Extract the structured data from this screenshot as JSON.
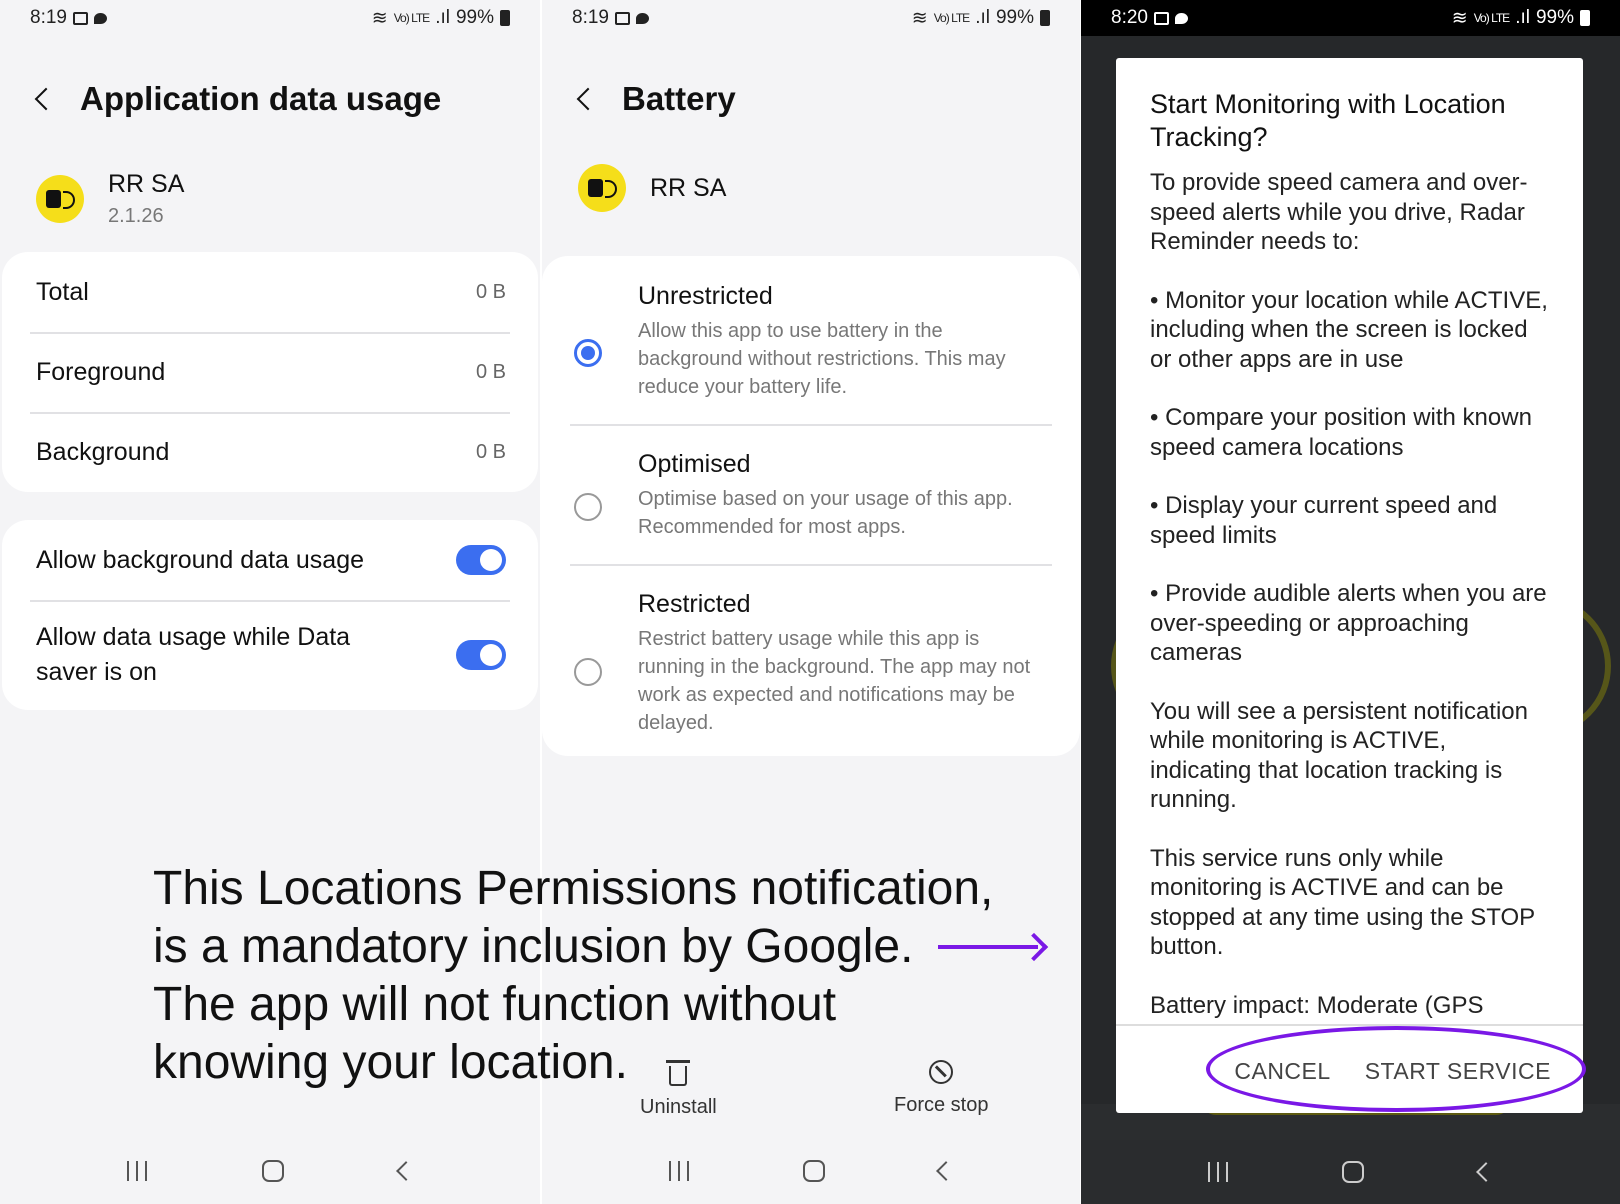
{
  "screen1": {
    "status": {
      "time": "8:19",
      "volte": "Vo) LTE",
      "battery": "99%"
    },
    "title": "Application data usage",
    "app": {
      "name": "RR SA",
      "version": "2.1.26"
    },
    "usage": [
      {
        "label": "Total",
        "value": "0 B"
      },
      {
        "label": "Foreground",
        "value": "0 B"
      },
      {
        "label": "Background",
        "value": "0 B"
      }
    ],
    "toggles": [
      {
        "label": "Allow background data usage",
        "on": true
      },
      {
        "label": "Allow data usage while Data saver is on",
        "on": true
      }
    ]
  },
  "screen2": {
    "status": {
      "time": "8:19",
      "volte": "Vo) LTE",
      "battery": "99%"
    },
    "title": "Battery",
    "app": {
      "name": "RR SA"
    },
    "options": [
      {
        "title": "Unrestricted",
        "desc": "Allow this app to use battery in the background without restrictions. This may reduce your battery life.",
        "selected": true
      },
      {
        "title": "Optimised",
        "desc": "Optimise based on your usage of this app. Recommended for most apps.",
        "selected": false
      },
      {
        "title": "Restricted",
        "desc": "Restrict battery usage while this app is running in the background. The app may not work as expected and notifications may be delayed.",
        "selected": false
      }
    ],
    "actions": {
      "uninstall": "Uninstall",
      "force_stop": "Force stop"
    }
  },
  "screen3": {
    "status": {
      "time": "8:20",
      "volte": "Vo) LTE",
      "battery": "99%"
    },
    "dialog": {
      "title": "Start Monitoring with Location Tracking?",
      "paragraphs": [
        "To provide speed camera and over-speed alerts while you drive, Radar Reminder needs to:",
        "• Monitor your location while ACTIVE, including when the screen is locked or other apps are in use",
        "• Compare your position with known speed camera locations",
        "• Display your current speed and speed limits",
        "• Provide audible alerts when you are over-speeding or approaching cameras",
        "You will see a persistent notification while monitoring is ACTIVE, indicating that location tracking is running.",
        "This service runs only while monitoring is ACTIVE and can be stopped at any time using the STOP button.",
        "Battery impact: Moderate (GPS"
      ],
      "cancel": "CANCEL",
      "start": "START SERVICE"
    }
  },
  "annotation": {
    "lines": [
      "This Locations Permissions notification,",
      "is a mandatory inclusion by Google.",
      "The app will not function without",
      "knowing your location."
    ]
  },
  "colors": {
    "accent": "#3b6ef0",
    "annotation": "#7a18e6",
    "app_icon": "#f5de1a"
  },
  "icons": [
    "back-icon",
    "app-icon",
    "radio-icon",
    "trash-icon",
    "force-stop-icon",
    "recent-apps-icon",
    "home-icon",
    "nav-back-icon",
    "arrow-icon"
  ]
}
